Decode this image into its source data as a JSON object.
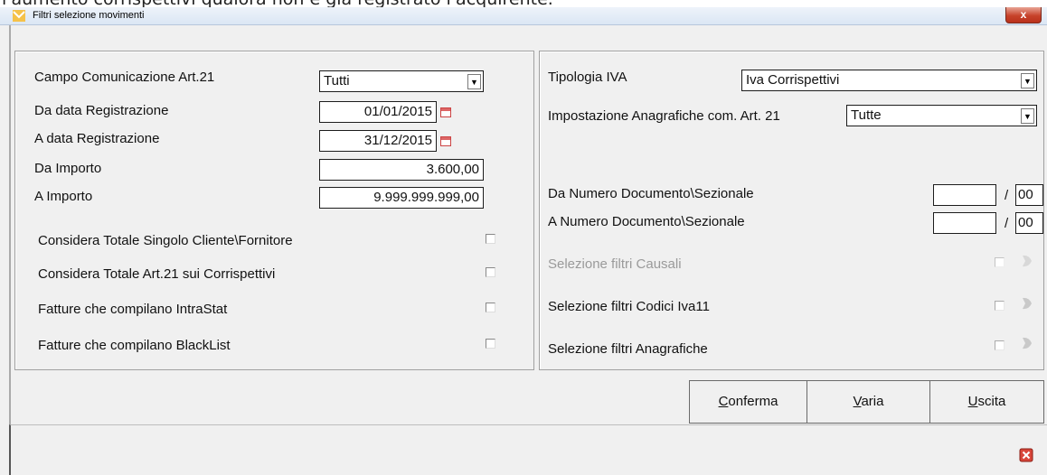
{
  "background": {
    "partial_text": "l'aumento corrispettivi qualora non è già registrato l'acquirente."
  },
  "window": {
    "title": "Filtri selezione movimenti",
    "close_label": "x"
  },
  "left": {
    "campo_label": "Campo Comunicazione Art.21",
    "campo_value": "Tutti",
    "da_data_label": "Da data Registrazione",
    "da_data_value": "01/01/2015",
    "a_data_label": "A data Registrazione",
    "a_data_value": "31/12/2015",
    "da_importo_label": "Da Importo",
    "da_importo_value": "3.600,00",
    "a_importo_label": "A Importo",
    "a_importo_value": "9.999.999.999,00",
    "checks": [
      {
        "label": "Considera Totale Singolo Cliente\\Fornitore",
        "checked": false
      },
      {
        "label": "Considera Totale Art.21 sui Corrispettivi",
        "checked": false
      },
      {
        "label": "Fatture che compilano IntraStat",
        "checked": false
      },
      {
        "label": "Fatture che compilano BlackList",
        "checked": false
      }
    ]
  },
  "right": {
    "tipologia_label": "Tipologia IVA",
    "tipologia_value": "Iva Corrispettivi",
    "impostazione_label": "Impostazione Anagrafiche com. Art. 21",
    "impostazione_value": "Tutte",
    "da_numero_label": "Da Numero Documento\\Sezionale",
    "da_numero_doc": "",
    "da_numero_sez": "00",
    "a_numero_label": "A Numero Documento\\Sezionale",
    "a_numero_doc": "",
    "a_numero_sez": "00",
    "separator": "/",
    "filters": [
      {
        "label": "Selezione filtri Causali",
        "enabled": false,
        "checked": false
      },
      {
        "label": "Selezione filtri Codici Iva11",
        "enabled": true,
        "checked": false
      },
      {
        "label": "Selezione filtri Anagrafiche",
        "enabled": true,
        "checked": false
      }
    ]
  },
  "buttons": {
    "conferma_first": "C",
    "conferma_rest": "onferma",
    "varia_first": "V",
    "varia_rest": "aria",
    "uscita_first": "U",
    "uscita_rest": "scita"
  },
  "icons": {
    "dropdown": "chevron-down-icon",
    "calendar": "calendar-icon",
    "filter": "filter-icon",
    "exit": "exit-icon"
  },
  "colors": {
    "titlebar": "#dbe6f4",
    "close": "#c7432b",
    "background": "#f0f0f0"
  }
}
